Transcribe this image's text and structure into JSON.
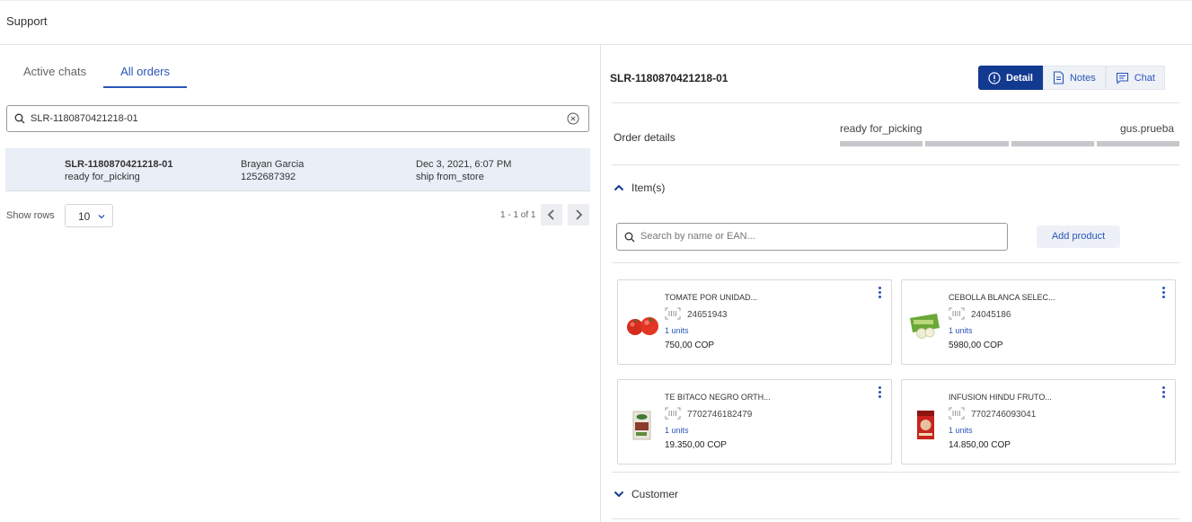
{
  "topbar": {
    "title": "Support"
  },
  "left": {
    "tabs": [
      {
        "label": "Active chats",
        "active": false
      },
      {
        "label": "All orders",
        "active": true
      }
    ],
    "search": {
      "value": "SLR-1180870421218-01"
    },
    "orders": [
      {
        "id": "SLR-1180870421218-01",
        "status": "ready for_picking",
        "customer": "Brayan Garcia",
        "phone": "1252687392",
        "date": "Dec 3, 2021, 6:07 PM",
        "delivery": "ship from_store"
      }
    ],
    "pager": {
      "rows_label": "Show rows",
      "rows_value": "10",
      "count": "1 - 1 of 1"
    }
  },
  "right": {
    "order_id": "SLR-1180870421218-01",
    "buttons": {
      "detail": "Detail",
      "notes": "Notes",
      "chat": "Chat"
    },
    "order_details": {
      "label": "Order details",
      "status": "ready for_picking",
      "user": "gus.prueba",
      "progress_segments": 4
    },
    "items": {
      "header": "Item(s)",
      "search_placeholder": "Search by name or EAN...",
      "add_label": "Add product",
      "list": [
        {
          "name": "TOMATE POR UNIDAD...",
          "ean": "24651943",
          "units": "1 units",
          "price": "750,00 COP",
          "icon": "tomato-image"
        },
        {
          "name": "CEBOLLA BLANCA SELEC...",
          "ean": "24045186",
          "units": "1 units",
          "price": "5980,00 COP",
          "icon": "onion-image"
        },
        {
          "name": "TE BITACO NEGRO ORTH...",
          "ean": "7702746182479",
          "units": "1 units",
          "price": "19.350,00 COP",
          "icon": "tea-box-image"
        },
        {
          "name": "INFUSION HINDU FRUTO...",
          "ean": "7702746093041",
          "units": "1 units",
          "price": "14.850,00 COP",
          "icon": "infusion-box-image"
        }
      ]
    },
    "customer": {
      "header": "Customer"
    },
    "colors": {
      "accent": "#123a91",
      "link": "#2a55b8",
      "row_highlight": "#e9eef7"
    }
  }
}
